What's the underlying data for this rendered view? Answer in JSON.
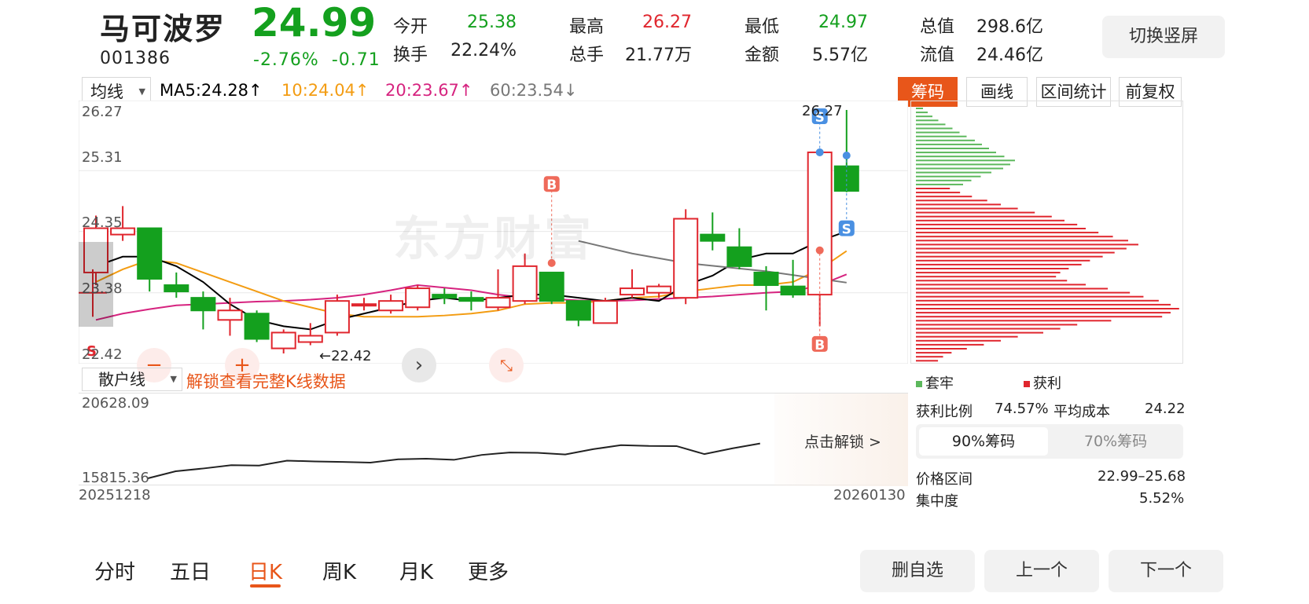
{
  "stock": {
    "name": "马可波罗",
    "code": "001386",
    "price": "24.99",
    "change_pct": "-2.76%",
    "change_amt": "-0.71"
  },
  "stats": [
    {
      "label": "今开",
      "value": "25.38",
      "color": "#14a01e"
    },
    {
      "label": "最高",
      "value": "26.27",
      "color": "#e0262e"
    },
    {
      "label": "最低",
      "value": "24.97",
      "color": "#14a01e"
    },
    {
      "label": "总值",
      "value": "298.6亿",
      "color": "#222"
    },
    {
      "label": "换手",
      "value": "22.24%",
      "color": "#222"
    },
    {
      "label": "总手",
      "value": "21.77万",
      "color": "#222"
    },
    {
      "label": "金额",
      "value": "5.57亿",
      "color": "#222"
    },
    {
      "label": "流值",
      "value": "24.46亿",
      "color": "#222"
    }
  ],
  "switch_label": "切换竖屏",
  "toolbar": {
    "ma_select": "均线",
    "ma5": "MA5:24.28↑",
    "ma10": "10:24.04↑",
    "ma20": "20:23.67↑",
    "ma60": "60:23.54↓",
    "chip": "筹码",
    "draw": "画线",
    "range_stats": "区间统计",
    "adjust": "前复权"
  },
  "chart_axis": {
    "top": "26.27",
    "l2": "25.31",
    "l3": "24.35",
    "l4": "23.38",
    "bottom": "22.42",
    "high_marker": "26.27",
    "low_marker": "←22.42",
    "watermark": "东方财富"
  },
  "markers": {
    "b": "B",
    "s": "S"
  },
  "sub_chart": {
    "indicator": "散户线",
    "unlock_hint": "解锁查看完整K线数据",
    "top_value": "20628.09",
    "bottom_value": "15815.36",
    "date_start": "20251218",
    "date_end": "20260130",
    "unlock_btn": "点击解锁 >"
  },
  "chip_panel": {
    "legend_trapped": "套牢",
    "legend_profit": "获利",
    "profit_ratio_label": "获利比例",
    "profit_ratio": "74.57%",
    "avg_cost_label": "平均成本",
    "avg_cost": "24.22",
    "tab_90": "90%筹码",
    "tab_70": "70%筹码",
    "price_range_label": "价格区间",
    "price_range": "22.99–25.68",
    "concentration_label": "集中度",
    "concentration": "5.52%"
  },
  "tabs": [
    "分时",
    "五日",
    "日K",
    "周K",
    "月K",
    "更多"
  ],
  "active_tab": "日K",
  "bottom_buttons": {
    "remove": "删自选",
    "prev": "上一个",
    "next": "下一个"
  },
  "colors": {
    "up": "#e0262e",
    "down": "#14a01e",
    "ma5": "#000000",
    "ma10": "#f39c12",
    "ma20": "#d6237f",
    "ma60": "#777777",
    "accent": "#e8561a",
    "marker_blue": "#4a90e2",
    "marker_red": "#ef6a5a"
  },
  "chart_data": {
    "type": "candlestick",
    "ylim": [
      22.42,
      26.27
    ],
    "candles": [
      {
        "o": 23.7,
        "c": 24.4,
        "h": 24.6,
        "l": 23.5
      },
      {
        "o": 24.3,
        "c": 24.4,
        "h": 24.75,
        "l": 24.2
      },
      {
        "o": 24.4,
        "c": 23.6,
        "h": 24.4,
        "l": 23.4
      },
      {
        "o": 23.5,
        "c": 23.4,
        "h": 23.7,
        "l": 23.3
      },
      {
        "o": 23.3,
        "c": 23.1,
        "h": 23.4,
        "l": 22.8
      },
      {
        "o": 22.95,
        "c": 23.1,
        "h": 23.3,
        "l": 22.7
      },
      {
        "o": 23.05,
        "c": 22.65,
        "h": 23.1,
        "l": 22.6
      },
      {
        "o": 22.5,
        "c": 22.75,
        "h": 22.8,
        "l": 22.42
      },
      {
        "o": 22.6,
        "c": 22.7,
        "h": 22.9,
        "l": 22.55
      },
      {
        "o": 22.75,
        "c": 23.25,
        "h": 23.35,
        "l": 22.7
      },
      {
        "o": 23.2,
        "c": 23.2,
        "h": 23.3,
        "l": 23.1
      },
      {
        "o": 23.1,
        "c": 23.25,
        "h": 23.35,
        "l": 23.05
      },
      {
        "o": 23.15,
        "c": 23.45,
        "h": 23.5,
        "l": 23.1
      },
      {
        "o": 23.35,
        "c": 23.3,
        "h": 23.45,
        "l": 23.2
      },
      {
        "o": 23.3,
        "c": 23.25,
        "h": 23.4,
        "l": 23.1
      },
      {
        "o": 23.15,
        "c": 23.3,
        "h": 23.75,
        "l": 23.1
      },
      {
        "o": 23.25,
        "c": 23.8,
        "h": 24.0,
        "l": 23.2
      },
      {
        "o": 23.7,
        "c": 23.25,
        "h": 23.7,
        "l": 23.2
      },
      {
        "o": 23.25,
        "c": 22.95,
        "h": 23.25,
        "l": 22.85
      },
      {
        "o": 22.9,
        "c": 23.25,
        "h": 23.3,
        "l": 22.9
      },
      {
        "o": 23.35,
        "c": 23.45,
        "h": 23.75,
        "l": 23.3
      },
      {
        "o": 23.38,
        "c": 23.48,
        "h": 23.52,
        "l": 23.3
      },
      {
        "o": 23.3,
        "c": 24.55,
        "h": 24.7,
        "l": 23.2
      },
      {
        "o": 24.3,
        "c": 24.2,
        "h": 24.65,
        "l": 24.05
      },
      {
        "o": 24.1,
        "c": 23.8,
        "h": 24.4,
        "l": 23.75
      },
      {
        "o": 23.7,
        "c": 23.5,
        "h": 23.8,
        "l": 23.1
      },
      {
        "o": 23.48,
        "c": 23.35,
        "h": 23.9,
        "l": 23.3
      },
      {
        "o": 23.35,
        "c": 25.6,
        "h": 25.6,
        "l": 22.85
      },
      {
        "o": 25.38,
        "c": 24.99,
        "h": 26.27,
        "l": 24.97
      }
    ],
    "ma5": [
      23.8,
      23.95,
      23.95,
      23.8,
      23.55,
      23.2,
      22.95,
      22.85,
      22.8,
      22.95,
      23.05,
      23.15,
      23.25,
      23.3,
      23.25,
      23.3,
      23.35,
      23.35,
      23.3,
      23.25,
      23.3,
      23.25,
      23.5,
      23.65,
      23.9,
      24.0,
      24.0,
      24.2,
      24.35
    ],
    "ma10": [
      23.55,
      23.75,
      23.9,
      23.85,
      23.7,
      23.55,
      23.4,
      23.25,
      23.15,
      23.05,
      23.0,
      23.0,
      23.0,
      23.02,
      23.05,
      23.1,
      23.2,
      23.22,
      23.22,
      23.25,
      23.3,
      23.32,
      23.4,
      23.45,
      23.5,
      23.5,
      23.55,
      23.75,
      24.04
    ],
    "ma20": [
      22.95,
      23.05,
      23.12,
      23.18,
      23.2,
      23.22,
      23.24,
      23.25,
      23.27,
      23.3,
      23.35,
      23.42,
      23.5,
      23.46,
      23.42,
      23.35,
      23.3,
      23.28,
      23.26,
      23.25,
      23.26,
      23.28,
      23.3,
      23.32,
      23.35,
      23.38,
      23.4,
      23.5,
      23.67
    ],
    "ma60_points": [
      [
        18,
        24.2
      ],
      [
        20,
        24.0
      ],
      [
        22,
        23.85
      ],
      [
        25,
        23.72
      ],
      [
        28,
        23.54
      ]
    ],
    "retail_line": [
      15815.36,
      16250,
      16420,
      16620,
      16600,
      16900,
      16850,
      16820,
      16780,
      16980,
      17020,
      16950,
      17250,
      17400,
      17380,
      17280,
      17600,
      17850,
      17800,
      17790,
      17300,
      17650,
      17950
    ]
  },
  "chip_dist": {
    "green": [
      12,
      20,
      28,
      38,
      50,
      62,
      74,
      86,
      100,
      112,
      124,
      136,
      150,
      168,
      160,
      148,
      128,
      110,
      94,
      80
    ],
    "red": [
      40,
      52,
      66,
      84,
      100,
      120,
      140,
      160,
      175,
      190,
      200,
      215,
      232,
      250,
      262,
      248,
      234,
      220,
      205,
      195,
      180,
      170,
      165,
      178,
      200,
      226,
      252,
      268,
      286,
      300,
      310,
      300,
      290,
      230,
      190,
      170,
      150,
      120,
      100,
      80,
      60,
      42,
      32,
      26,
      22,
      18
    ]
  }
}
